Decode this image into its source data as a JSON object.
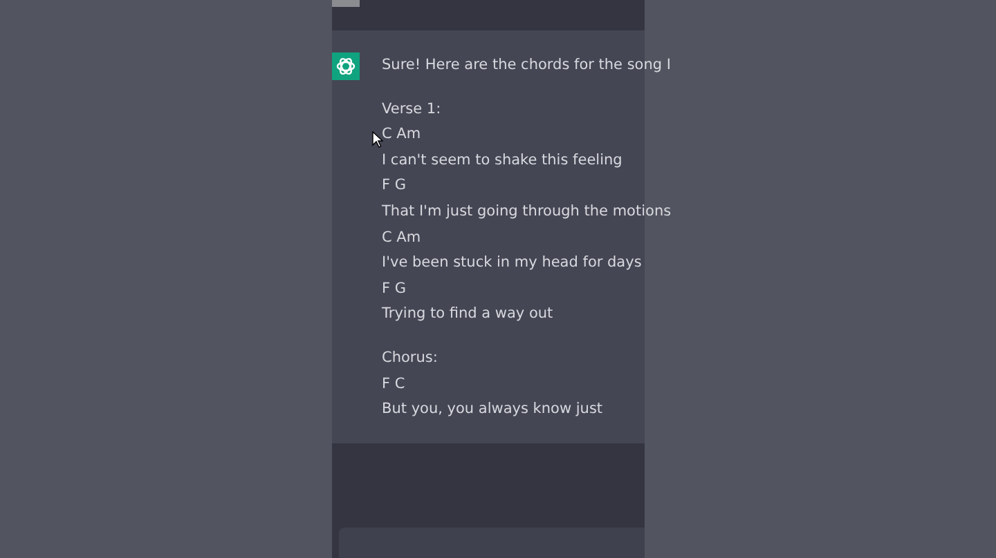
{
  "assistant_message": {
    "intro": "Sure! Here are the chords for the song I",
    "sections": [
      {
        "lines": [
          "Verse 1:",
          "C Am",
          "I can't seem to shake this feeling",
          "F G",
          "That I'm just going through the motions",
          "C Am",
          "I've been stuck in my head for days",
          "F G",
          "Trying to find a way out"
        ]
      },
      {
        "lines": [
          "Chorus:",
          "F C",
          "But you, you always know just"
        ]
      }
    ]
  }
}
